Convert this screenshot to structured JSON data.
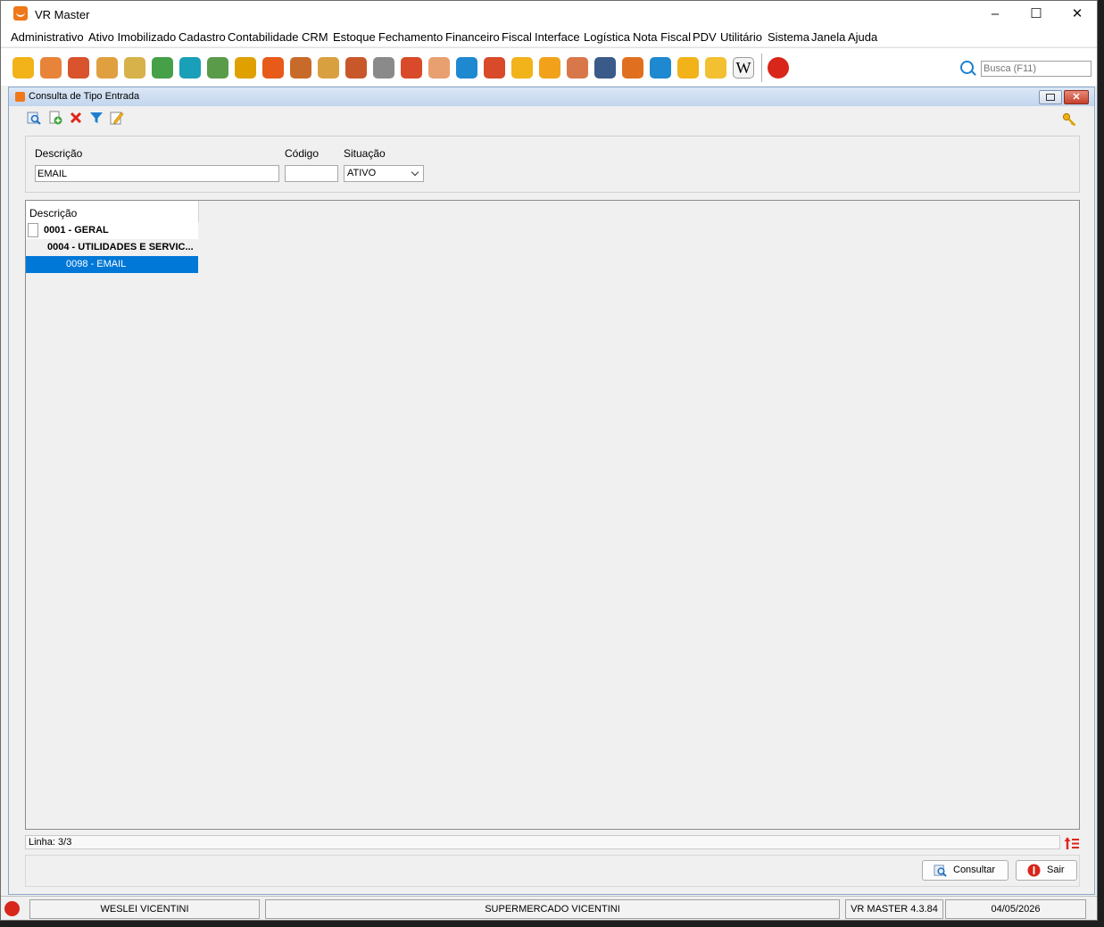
{
  "window": {
    "title": "VR Master"
  },
  "menu": [
    "Administrativo",
    "Ativo Imobilizado",
    "Cadastro",
    "Contabilidade",
    "CRM",
    "Estoque",
    "Fechamento",
    "Financeiro",
    "Fiscal",
    "Interface",
    "Logística",
    "Nota Fiscal",
    "PDV",
    "Utilitário",
    "Sistema",
    "Janela",
    "Ajuda"
  ],
  "search": {
    "placeholder": "Busca (F11)"
  },
  "internal_window": {
    "title": "Consulta de Tipo Entrada",
    "filters": {
      "descricao_label": "Descrição",
      "descricao_value": "EMAIL",
      "codigo_label": "Código",
      "codigo_value": "",
      "situacao_label": "Situação",
      "situacao_value": "ATIVO"
    },
    "tree": {
      "header": "Descrição",
      "rows": [
        {
          "label": "0001 - GERAL",
          "level": 0,
          "selected": false
        },
        {
          "label": "0004 - UTILIDADES E SERVIC...",
          "level": 1,
          "selected": false
        },
        {
          "label": "0098 - EMAIL",
          "level": 2,
          "selected": true
        }
      ]
    },
    "status_text": "Linha: 3/3",
    "buttons": {
      "consultar": "Consultar",
      "sair": "Sair"
    }
  },
  "statusbar": {
    "user": "WESLEI VICENTINI",
    "company": "SUPERMERCADO VICENTINI",
    "version": "VR MASTER 4.3.84",
    "date": "04/05/2026"
  },
  "colors": {
    "accent": "#0078d7",
    "brand": "#f07818",
    "exit": "#d8261b"
  },
  "toolbar_icons": [
    "money-icon",
    "user-icon",
    "presentation-icon",
    "money-bag-icon",
    "coins-document-icon",
    "document-arrow-icon",
    "transfer-icon",
    "checklist-icon",
    "hierarchy-icon",
    "offer-badge-icon",
    "truck-icon",
    "money-hand-icon",
    "box-minus-icon",
    "shopping-cart-icon",
    "megaphone-icon",
    "support-agent-icon",
    "card-refresh-icon",
    "cash-register-icon",
    "folder-in-icon",
    "folder-out-icon",
    "document-export-icon",
    "globe-icon",
    "store-cart-icon",
    "chat-icon",
    "lock-icon",
    "envelope-icon",
    "wiki-icon",
    "power-icon"
  ]
}
